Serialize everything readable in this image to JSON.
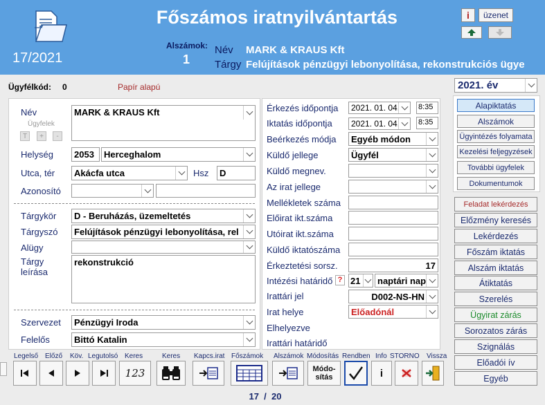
{
  "header": {
    "title": "Főszámos iratnyilvántartás",
    "reg_number": "17/2021",
    "sub_label": "Alszámok:",
    "sub_count": "1",
    "name_label": "Név",
    "name_value": "MARK & KRAUS Kft",
    "subject_label": "Tárgy",
    "subject_value": "Felújítások pénzügyi lebonyolítása, rekonstrukciós ügye",
    "info_icon": "i",
    "message_button": "üzenet"
  },
  "client_bar": {
    "label": "Ügyfélkód:",
    "value": "0",
    "paper": "Papír alapú"
  },
  "year": "2021. év",
  "left": {
    "nev_label": "Név",
    "nev_value": "MARK & KRAUS Kft",
    "ugyfelek_label": "Ügyfelek",
    "mini_t": "T",
    "mini_plus": "+",
    "mini_minus": "-",
    "helyseg_label": "Helység",
    "zip": "2053",
    "city": "Herceghalom",
    "utca_label": "Utca, tér",
    "street": "Akácfa utca",
    "hsz_label": "Hsz",
    "hsz": "D",
    "azonosito_label": "Azonosító",
    "targykor_label": "Tárgykör",
    "targykor": "D - Beruházás, üzemeltetés",
    "targyszo_label": "Tárgyszó",
    "targyszo": "Felújítások pénzügyi lebonyolítása, rel",
    "aluegy_label": "Alügy",
    "targy_leiras_label1": "Tárgy",
    "targy_leiras_label2": "leírása",
    "targy_leiras": "rekonstrukció",
    "szervezet_label": "Szervezet",
    "szervezet": "Pénzügyi Iroda",
    "felelos_label": "Felelős",
    "felelos": "Bittó Katalin"
  },
  "middle": {
    "erkezes_label": "Érkezés időpontja",
    "erkezes_date": "2021. 01. 04.",
    "erkezes_time": "8:35",
    "iktatas_label": "Iktatás időpontja",
    "iktatas_date": "2021. 01. 04.",
    "iktatas_time": "8:35",
    "beerkezes_label": "Beérkezés módja",
    "beerkezes": "Egyéb módon",
    "kuldo_jellege_label": "Küldő jellege",
    "kuldo_jellege": "Ügyfél",
    "kuldo_megnev_label": "Küldő megnev.",
    "irat_jellege_label": "Az irat jellege",
    "mellekletek_label": "Mellékletek száma",
    "eloirat_label": "Előirat ikt.száma",
    "utoirat_label": "Utóirat ikt.száma",
    "kuldo_iktato_label": "Küldő iktatószáma",
    "erkeztetesi_label": "Érkeztetési sorsz.",
    "erkeztetesi": "17",
    "hatarido_label": "Intézési határidő",
    "help_icon": "?",
    "hatarido_num": "21",
    "hatarido_unit": "naptári nap",
    "irattari_jel_label": "Irattári jel",
    "irattari_jel": "D002-NS-HN",
    "irat_helye_label": "Irat helye",
    "irat_helye": "Előadónál",
    "elhelyezve_label": "Elhelyezve",
    "irattari_hatarido_label": "Irattári határidő"
  },
  "right_top_buttons": [
    "Alapiktatás",
    "Alszámok",
    "Ügyintézés folyamata",
    "Kezelési feljegyzések",
    "További ügyfelek",
    "Dokumentumok"
  ],
  "right_buttons": [
    "Feladat lekérdezés",
    "Előzmény keresés",
    "Lekérdezés",
    "Főszám iktatás",
    "Alszám iktatás",
    "Átiktatás",
    "Szerelés",
    "Ügyirat zárás",
    "Sorozatos zárás",
    "Szignálás",
    "Előadói ív",
    "Egyéb"
  ],
  "toolbar": {
    "labels": [
      "Legelső",
      "Előző",
      "Köv.",
      "Legutolsó",
      "Keres",
      "Keres",
      "Kapcs.irat",
      "Főszámok",
      "Alszámok",
      "Módosítás",
      "Rendben",
      "Info",
      "STORNO",
      "Vissza"
    ],
    "keres_text": "123",
    "modosit_text1": "Módo-",
    "modosit_text2": "sítás",
    "info_text": "i"
  },
  "pager": "17  /  20",
  "colors": {
    "header": "#5ba0e0",
    "label": "#1a2a6e",
    "accent_red": "#b22222",
    "green": "#1a8a2a"
  }
}
